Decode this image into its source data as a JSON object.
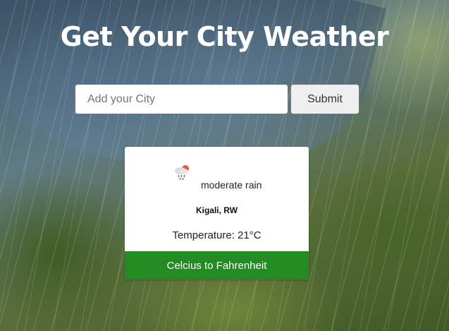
{
  "page": {
    "title": "Get Your City Weather"
  },
  "search": {
    "placeholder": "Add your City",
    "value": "",
    "submit_label": "Submit"
  },
  "weather": {
    "icon": "rain-cloud-icon",
    "condition": "moderate rain",
    "location": "Kigali, RW",
    "temperature_text": "Temperature: 21°C",
    "convert_label": "Celcius to Fahrenheit"
  },
  "colors": {
    "convert_button": "#228b22",
    "title_text": "#ffffff"
  }
}
